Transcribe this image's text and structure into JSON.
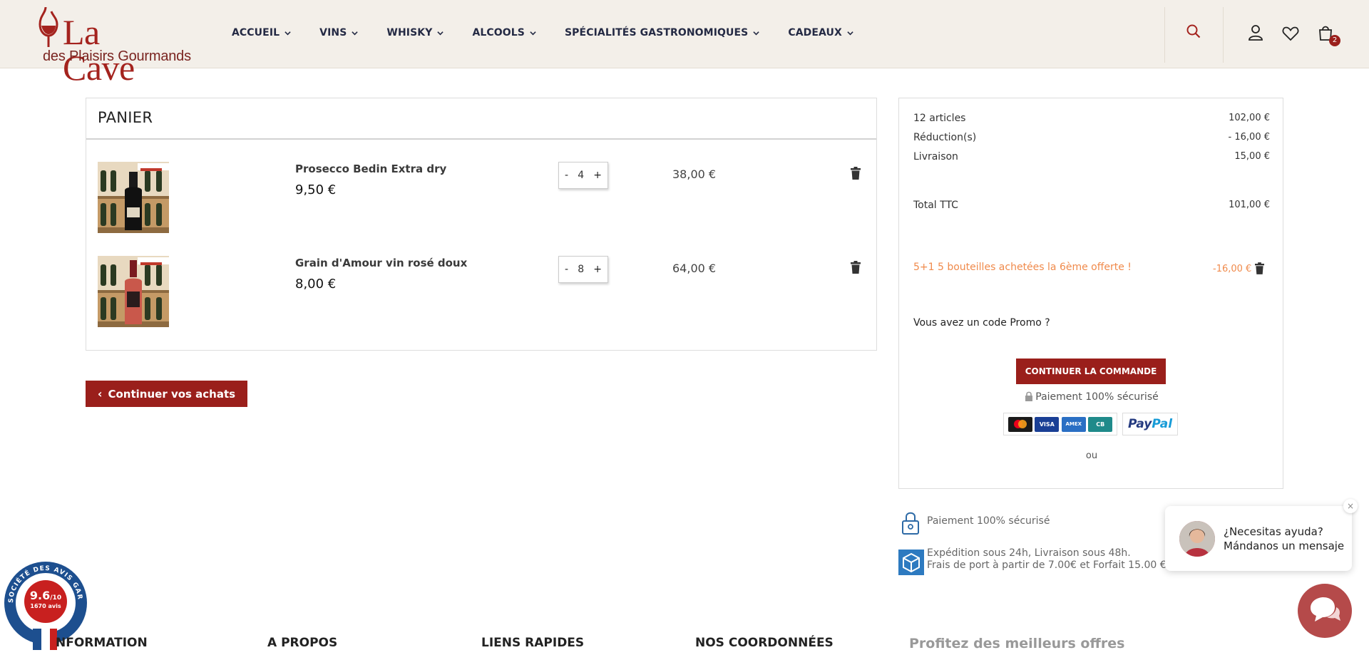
{
  "header": {
    "logo": {
      "title": "La Cave",
      "subtitle": "des Plaisirs Gourmands"
    },
    "nav": [
      {
        "label": "ACCUEIL"
      },
      {
        "label": "VINS"
      },
      {
        "label": "WHISKY"
      },
      {
        "label": "ALCOOLS"
      },
      {
        "label": "SPÉCIALITÉS GASTRONOMIQUES"
      },
      {
        "label": "CADEAUX"
      }
    ],
    "cart_count": "2",
    "icons": [
      "search-icon",
      "user-icon",
      "heart-icon",
      "cart-icon"
    ]
  },
  "cart": {
    "title": "PANIER",
    "items": [
      {
        "name": "Prosecco Bedin Extra dry",
        "unit_price": "9,50 €",
        "quantity": "4",
        "total": "38,00 €",
        "image": "bottle-dark"
      },
      {
        "name": "Grain d'Amour vin rosé doux",
        "unit_price": "8,00 €",
        "quantity": "8",
        "total": "64,00 €",
        "image": "bottle-rose"
      }
    ],
    "qty_minus": "-",
    "qty_plus": "+",
    "continue_label": "Continuer vos achats"
  },
  "summary": {
    "articles_label": "12 articles",
    "articles_value": "102,00 €",
    "reduction_label": "Réduction(s)",
    "reduction_value": "- 16,00 €",
    "shipping_label": "Livraison",
    "shipping_value": "15,00 €",
    "total_label": "Total TTC",
    "total_value": "101,00 €",
    "promo_applied": "5+1 5 bouteilles achetées la 6ème offerte !",
    "promo_value": "-16,00 €",
    "promo_code_label": "Vous avez un code Promo ?",
    "checkout_label": "CONTINUER LA COMMANDE",
    "secure_label": "Paiement 100% sécurisé",
    "cards": [
      "mastercard",
      "VISA",
      "AMEX",
      "CB"
    ],
    "paypal_pay": "Pay",
    "paypal_pal": "Pal",
    "or_label": "ou"
  },
  "reassurance": {
    "secure": "Paiement 100% sécurisé",
    "shipping_line1": "Expédition sous 24h, Livraison sous 48h.",
    "shipping_line2": "Frais de port à partir de 7.00€ et Forfait 15.00 €"
  },
  "chat": {
    "line1": "¿Necesitas ayuda?",
    "line2": "Mándanos un mensaje",
    "close": "×"
  },
  "badge": {
    "score": "9.6",
    "scale": "/10",
    "reviews": "1670 avis",
    "ring_text": "SOCIÉTÉ DES AVIS GARANTIS"
  },
  "footer": {
    "headings": [
      "NFORMATION",
      "A PROPOS",
      "LIENS RAPIDES",
      "NOS COORDONNÉES"
    ],
    "offers": "Profitez des meilleurs offres"
  },
  "colors": {
    "brand": "#9a1f1b",
    "header_bg": "#f3efe9",
    "promo": "#f08a4b",
    "nav_text": "#242a44"
  }
}
